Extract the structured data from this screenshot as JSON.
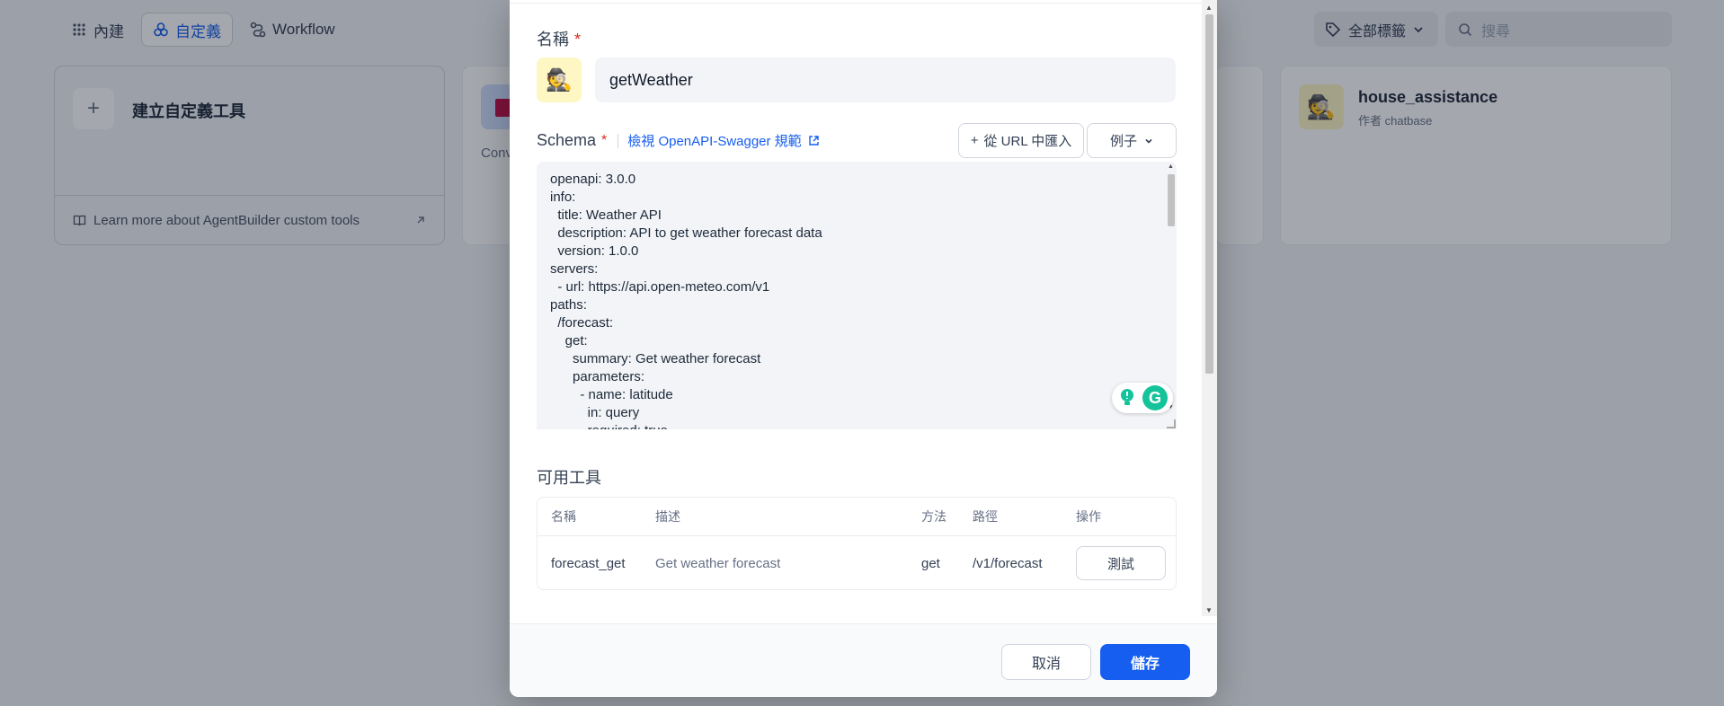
{
  "nav": {
    "tabs": [
      {
        "label": "內建",
        "icon": "grid-icon"
      },
      {
        "label": "自定義",
        "icon": "shapes-icon"
      },
      {
        "label": "Workflow",
        "icon": "workflow-icon"
      }
    ],
    "active_tab": "自定義"
  },
  "filters": {
    "tag_label": "全部標籤",
    "search_placeholder": "搜尋"
  },
  "cards": {
    "create": {
      "label": "建立自定義工具",
      "footer": "Learn more about AgentBuilder custom tools"
    },
    "partial_card_text": "Conv",
    "house": {
      "name": "house_assistance",
      "author": "作者 chatbase",
      "avatar": "🕵️"
    }
  },
  "modal": {
    "name_label": "名稱",
    "required_mark": "*",
    "avatar": "🕵️",
    "name_value": "getWeather",
    "schema_label": "Schema",
    "schema_link": "檢視 OpenAPI-Swagger 規範",
    "import_url_button": "從 URL 中匯入",
    "example_button": "例子",
    "schema_lines": [
      "openapi: 3.0.0",
      "info:",
      "  title: Weather API",
      "  description: API to get weather forecast data",
      "  version: 1.0.0",
      "servers:",
      "  - url: https://api.open-meteo.com/v1",
      "paths:",
      "  /forecast:",
      "    get:",
      "      summary: Get weather forecast",
      "      parameters:",
      "        - name: latitude",
      "          in: query",
      "          required: true"
    ],
    "tools_label": "可用工具",
    "table": {
      "headers": [
        "名稱",
        "描述",
        "方法",
        "路徑",
        "操作"
      ],
      "rows": [
        {
          "name": "forecast_get",
          "description": "Get weather forecast",
          "method": "get",
          "path": "/v1/forecast",
          "action": "測試"
        }
      ]
    },
    "cancel_button": "取消",
    "save_button": "儲存"
  },
  "colors": {
    "accent": "#155eef",
    "required": "#d92d20",
    "grammarly": "#15c39a"
  }
}
